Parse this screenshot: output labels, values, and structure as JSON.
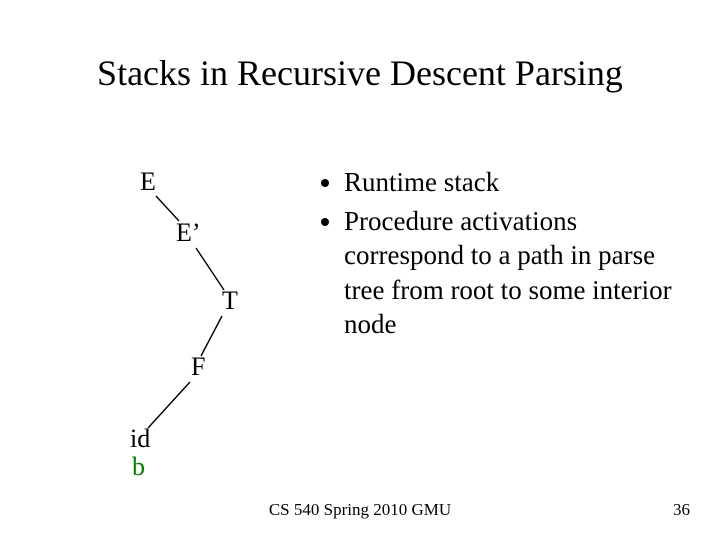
{
  "title": "Stacks in Recursive Descent Parsing",
  "tree": {
    "n0": "E",
    "n1": "E’",
    "n2": "T",
    "n3": "F",
    "n4": "id",
    "n5": "b"
  },
  "bullets": {
    "b0": "Runtime stack",
    "b1": "Procedure activations correspond to a path in parse tree from root to some interior node"
  },
  "footer": {
    "center": "CS 540 Spring 2010 GMU",
    "page": "36"
  }
}
